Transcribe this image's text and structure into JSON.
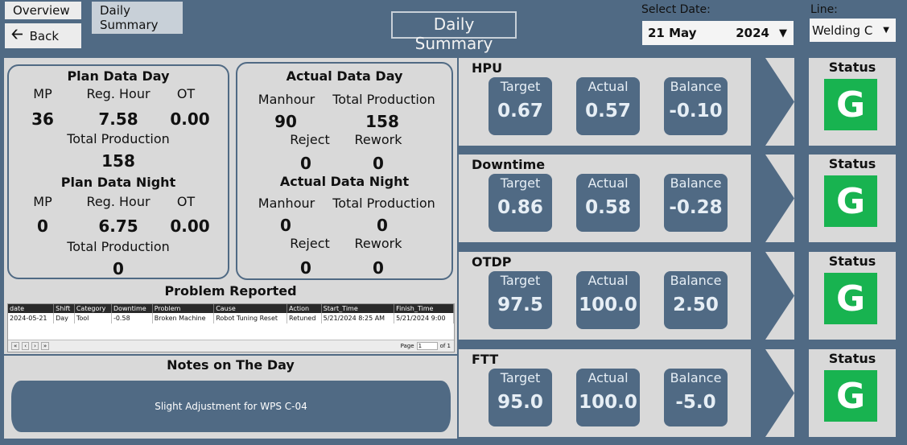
{
  "tabs": [
    "Overview",
    "Daily Summary"
  ],
  "back_label": "Back",
  "page_title": "Daily Summary",
  "select_date": {
    "label": "Select Date:",
    "day": "21",
    "month": "May",
    "year": "2024"
  },
  "line": {
    "label": "Line:",
    "value": "Welding C"
  },
  "plan_day": {
    "title": "Plan Data Day",
    "mp_label": "MP",
    "reg_label": "Reg. Hour",
    "ot_label": "OT",
    "mp": "36",
    "reg": "7.58",
    "ot": "0.00",
    "tp_label": "Total Production",
    "tp": "158"
  },
  "plan_night": {
    "title": "Plan Data Night",
    "mp_label": "MP",
    "reg_label": "Reg. Hour",
    "ot_label": "OT",
    "mp": "0",
    "reg": "6.75",
    "ot": "0.00",
    "tp_label": "Total Production",
    "tp": "0"
  },
  "actual_day": {
    "title": "Actual Data Day",
    "mh_label": "Manhour",
    "tp_label": "Total Production",
    "mh": "90",
    "tp": "158",
    "reject_label": "Reject",
    "rework_label": "Rework",
    "reject": "0",
    "rework": "0"
  },
  "actual_night": {
    "title": "Actual Data Night",
    "mh_label": "Manhour",
    "tp_label": "Total Production",
    "mh": "0",
    "tp": "0",
    "reject_label": "Reject",
    "rework_label": "Rework",
    "reject": "0",
    "rework": "0"
  },
  "problem": {
    "title": "Problem Reported",
    "columns": [
      "date",
      "Shift",
      "Category",
      "Downtime",
      "Problem",
      "Cause",
      "Action",
      "Start_Time",
      "Finish_Time"
    ],
    "rows": [
      [
        "2024-05-21",
        "Day",
        "Tool",
        "-0.58",
        "Broken Machine",
        "Robot Tuning Reset",
        "Retuned",
        "5/21/2024 8:25 AM",
        "5/21/2024 9:00"
      ]
    ],
    "page_label": "Page",
    "page_value": "1",
    "page_of": "of 1"
  },
  "notes": {
    "title": "Notes on The Day",
    "text": "Slight Adjustment for WPS C-04"
  },
  "kpis": [
    {
      "name": "HPU",
      "target": "0.67",
      "actual": "0.57",
      "balance": "-0.10",
      "status": "G"
    },
    {
      "name": "Downtime",
      "target": "0.86",
      "actual": "0.58",
      "balance": "-0.28",
      "status": "G"
    },
    {
      "name": "OTDP",
      "target": "97.5",
      "actual": "100.0",
      "balance": "2.50",
      "status": "G"
    },
    {
      "name": "FTT",
      "target": "95.0",
      "actual": "100.0",
      "balance": "-5.0",
      "status": "G"
    }
  ],
  "kpi_labels": {
    "target": "Target",
    "actual": "Actual",
    "balance": "Balance",
    "status": "Status"
  },
  "colors": {
    "background": "#506a84",
    "panel": "#d9d9d9",
    "status_green": "#18b350"
  }
}
